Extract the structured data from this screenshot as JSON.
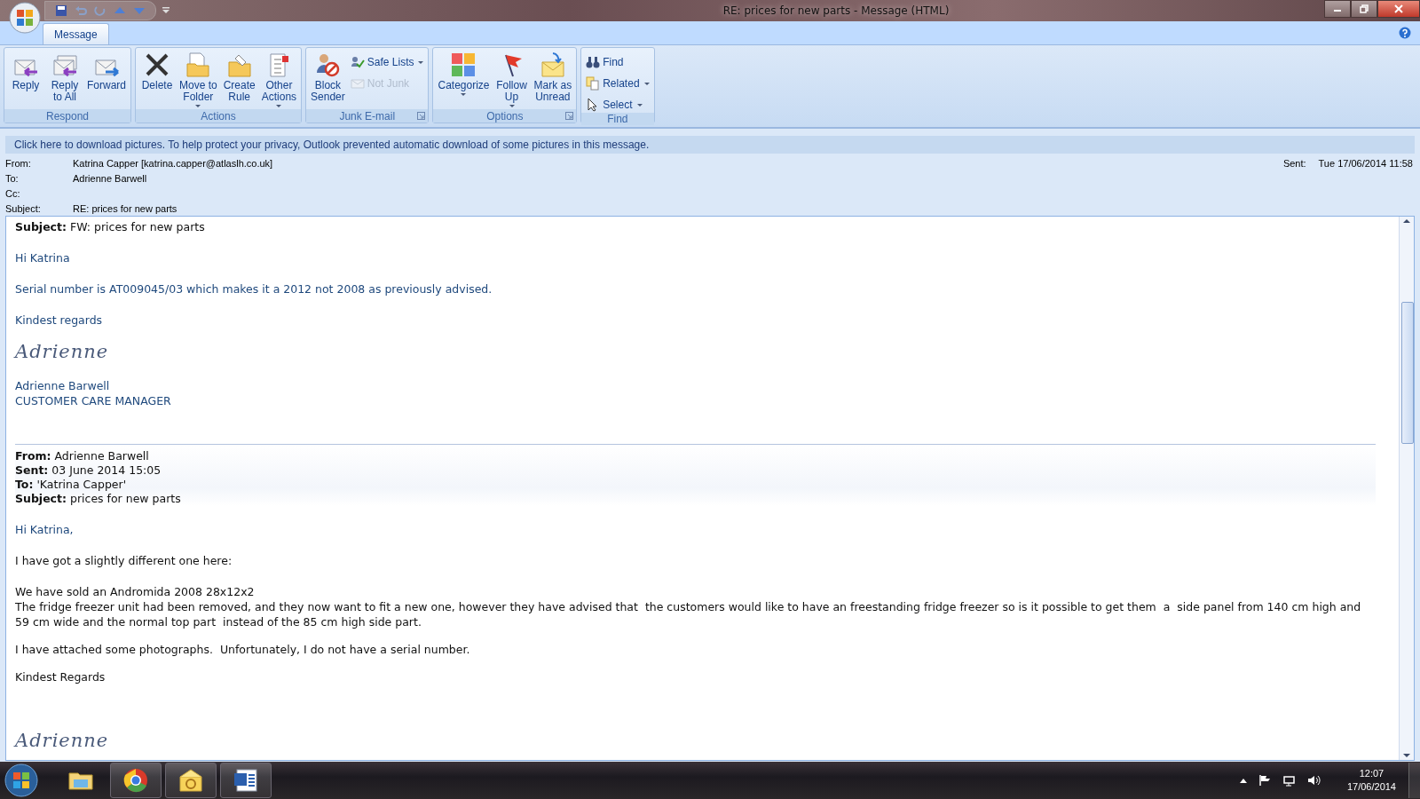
{
  "window": {
    "title": "RE: prices for new parts - Message (HTML)"
  },
  "tabs": [
    {
      "label": "Message",
      "selected": true
    }
  ],
  "ribbon": {
    "groups": [
      {
        "label": "Respond",
        "launcher": false,
        "buttons": [
          {
            "kind": "large",
            "label": "Reply",
            "dropdown": false,
            "disabled": false
          },
          {
            "kind": "large",
            "label": "Reply\nto All",
            "dropdown": false,
            "disabled": false
          },
          {
            "kind": "large",
            "label": "Forward",
            "dropdown": false,
            "disabled": false
          }
        ]
      },
      {
        "label": "Actions",
        "launcher": false,
        "buttons": [
          {
            "kind": "large",
            "label": "Delete",
            "dropdown": false,
            "disabled": false
          },
          {
            "kind": "large",
            "label": "Move to\nFolder",
            "dropdown": true,
            "disabled": false
          },
          {
            "kind": "large",
            "label": "Create\nRule",
            "dropdown": false,
            "disabled": false
          },
          {
            "kind": "large",
            "label": "Other\nActions",
            "dropdown": true,
            "disabled": false
          }
        ]
      },
      {
        "label": "Junk E-mail",
        "launcher": true,
        "buttons": [
          {
            "kind": "large",
            "label": "Block\nSender",
            "dropdown": false,
            "disabled": false
          },
          {
            "kind": "small",
            "label": "Safe Lists",
            "dropdown": true,
            "disabled": false
          },
          {
            "kind": "small",
            "label": "Not Junk",
            "dropdown": false,
            "disabled": true
          }
        ]
      },
      {
        "label": "Options",
        "launcher": true,
        "buttons": [
          {
            "kind": "large",
            "label": "Categorize",
            "dropdown": true,
            "disabled": false
          },
          {
            "kind": "large",
            "label": "Follow\nUp",
            "dropdown": true,
            "disabled": false
          },
          {
            "kind": "large",
            "label": "Mark as\nUnread",
            "dropdown": false,
            "disabled": false
          }
        ]
      },
      {
        "label": "Find",
        "launcher": false,
        "buttons": [
          {
            "kind": "small",
            "label": "Find",
            "dropdown": false,
            "disabled": false
          },
          {
            "kind": "small",
            "label": "Related",
            "dropdown": true,
            "disabled": false
          },
          {
            "kind": "small",
            "label": "Select",
            "dropdown": true,
            "disabled": false
          }
        ]
      }
    ]
  },
  "infobar": "Click here to download pictures. To help protect your privacy, Outlook prevented automatic download of some pictures in this message.",
  "header": {
    "fields": [
      {
        "label": "From:",
        "value": "Katrina Capper [katrina.capper@atlaslh.co.uk]"
      },
      {
        "label": "To:",
        "value": "Adrienne Barwell"
      },
      {
        "label": "Cc:"
      },
      {
        "label": "Subject:",
        "value": "RE: prices for new parts"
      }
    ],
    "sent": {
      "label": "Sent:",
      "value": "Tue 17/06/2014 11:58"
    }
  },
  "body": [
    {
      "kind": "text",
      "color": "#111111",
      "text": "**Subject:** FW: prices for new parts"
    },
    {
      "kind": "gap"
    },
    {
      "kind": "text",
      "color": "#1f497d",
      "text": "Hi Katrina"
    },
    {
      "kind": "gap"
    },
    {
      "kind": "text",
      "color": "#1f497d",
      "text": "Serial number is AT009045/03 which makes it a 2012 not 2008 as previously advised."
    },
    {
      "kind": "gap"
    },
    {
      "kind": "text",
      "color": "#1f497d",
      "text": "Kindest regards"
    },
    {
      "kind": "signature",
      "text": "Adrienne"
    },
    {
      "kind": "text",
      "color": "#1f497d",
      "text": "Adrienne Barwell"
    },
    {
      "kind": "text",
      "color": "#1f497d",
      "text": "CUSTOMER CARE MANAGER"
    },
    {
      "kind": "quote",
      "lines": [
        "**From:** Adrienne Barwell",
        "**Sent:** 03 June 2014 15:05",
        "**To:** 'Katrina Capper'",
        "**Subject:** prices for new parts"
      ]
    },
    {
      "kind": "text",
      "color": "#1f497d",
      "text": "Hi Katrina,"
    },
    {
      "kind": "gap"
    },
    {
      "kind": "text",
      "color": "#111111",
      "text": "I have got a slightly different one here:"
    },
    {
      "kind": "gap"
    },
    {
      "kind": "text",
      "color": "#111111",
      "text": "We have sold an Andromida 2008 28x12x2"
    },
    {
      "kind": "text",
      "color": "#111111",
      "text": "The fridge freezer unit had been removed, and they now want to fit a new one, however they have advised that  the customers would like to have an freestanding fridge freezer so is it possible to get them  a  side panel from 140 cm high and 59 cm wide and the normal top part  instead of the 85 cm high side part."
    },
    {
      "kind": "smallgap"
    },
    {
      "kind": "text",
      "color": "#111111",
      "text": "I have attached some photographs.  Unfortunately, I do not have a serial number."
    },
    {
      "kind": "smallgap"
    },
    {
      "kind": "text",
      "color": "#111111",
      "text": "Kindest Regards"
    },
    {
      "kind": "gap"
    },
    {
      "kind": "gap"
    },
    {
      "kind": "signature",
      "text": "Adrienne"
    }
  ],
  "taskbar": {
    "items": [
      {
        "running": false
      },
      {
        "running": true
      },
      {
        "running": true
      },
      {
        "running": true
      }
    ],
    "time": "12:07",
    "date": "17/06/2014"
  }
}
